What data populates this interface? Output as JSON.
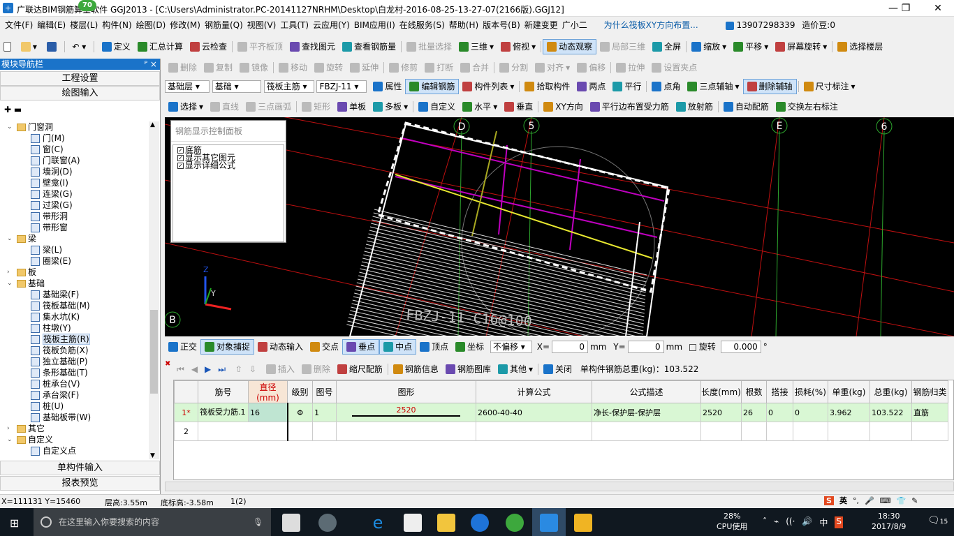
{
  "window": {
    "title": "广联达BIM钢筋算量软件 GGJ2013 - [C:\\Users\\Administrator.PC-20141127NRHM\\Desktop\\白龙村-2016-08-25-13-27-07(2166版).GGJ12]",
    "badge": "70"
  },
  "menu": {
    "items": [
      "文件(F)",
      "编辑(E)",
      "楼层(L)",
      "构件(N)",
      "绘图(D)",
      "修改(M)",
      "钢筋量(Q)",
      "视图(V)",
      "工具(T)",
      "云应用(Y)",
      "BIM应用(I)",
      "在线服务(S)",
      "帮助(H)",
      "版本号(B)",
      "新建变更",
      "广小二"
    ],
    "question": "为什么筏板XY方向布置...",
    "phone": "13907298339",
    "price": "造价豆:0"
  },
  "toolbar1": {
    "items": [
      "定义",
      "汇总计算",
      "云检查",
      "平齐板顶",
      "查找图元",
      "查看钢筋量",
      "批量选择",
      "三维",
      "俯视",
      "动态观察",
      "局部三维",
      "全屏",
      "缩放",
      "平移",
      "屏幕旋转",
      "选择楼层"
    ]
  },
  "toolbar2": {
    "items": [
      "删除",
      "复制",
      "镜像",
      "移动",
      "旋转",
      "延伸",
      "修剪",
      "打断",
      "合并",
      "分割",
      "对齐",
      "偏移",
      "拉伸",
      "设置夹点"
    ]
  },
  "toolbar3": {
    "floor": "基础层",
    "category": "基础",
    "type": "筏板主筋",
    "name": "FBZJ-11",
    "items": [
      "属性",
      "编辑钢筋",
      "构件列表",
      "拾取构件",
      "两点",
      "平行",
      "点角",
      "三点辅轴",
      "删除辅轴",
      "尺寸标注"
    ]
  },
  "toolbar4": {
    "items": [
      "选择",
      "直线",
      "三点画弧",
      "矩形",
      "单板",
      "多板",
      "自定义",
      "水平",
      "垂直",
      "XY方向",
      "平行边布置受力筋",
      "放射筋",
      "自动配筋",
      "交换左右标注"
    ]
  },
  "nav": {
    "header": "模块导航栏",
    "pin": "ᴾ ×",
    "btn_project": "工程设置",
    "btn_draw": "绘图输入",
    "btn_single": "单构件输入",
    "btn_report": "报表预览",
    "tree": [
      {
        "t": "folder",
        "label": "门窗洞",
        "lvl": 1,
        "open": true
      },
      {
        "t": "item",
        "label": "门(M)",
        "lvl": 2
      },
      {
        "t": "item",
        "label": "窗(C)",
        "lvl": 2
      },
      {
        "t": "item",
        "label": "门联窗(A)",
        "lvl": 2
      },
      {
        "t": "item",
        "label": "墙洞(D)",
        "lvl": 2
      },
      {
        "t": "item",
        "label": "壁龛(I)",
        "lvl": 2
      },
      {
        "t": "item",
        "label": "连梁(G)",
        "lvl": 2
      },
      {
        "t": "item",
        "label": "过梁(G)",
        "lvl": 2
      },
      {
        "t": "item",
        "label": "带形洞",
        "lvl": 2
      },
      {
        "t": "item",
        "label": "带形窗",
        "lvl": 2
      },
      {
        "t": "folder",
        "label": "梁",
        "lvl": 1,
        "open": true
      },
      {
        "t": "item",
        "label": "梁(L)",
        "lvl": 2
      },
      {
        "t": "item",
        "label": "圈梁(E)",
        "lvl": 2
      },
      {
        "t": "folder",
        "label": "板",
        "lvl": 1,
        "open": false
      },
      {
        "t": "folder",
        "label": "基础",
        "lvl": 1,
        "open": true
      },
      {
        "t": "item",
        "label": "基础梁(F)",
        "lvl": 2
      },
      {
        "t": "item",
        "label": "筏板基础(M)",
        "lvl": 2
      },
      {
        "t": "item",
        "label": "集水坑(K)",
        "lvl": 2
      },
      {
        "t": "item",
        "label": "柱墩(Y)",
        "lvl": 2
      },
      {
        "t": "item",
        "label": "筏板主筋(R)",
        "lvl": 2,
        "sel": true
      },
      {
        "t": "item",
        "label": "筏板负筋(X)",
        "lvl": 2
      },
      {
        "t": "item",
        "label": "独立基础(P)",
        "lvl": 2
      },
      {
        "t": "item",
        "label": "条形基础(T)",
        "lvl": 2
      },
      {
        "t": "item",
        "label": "桩承台(V)",
        "lvl": 2
      },
      {
        "t": "item",
        "label": "承台梁(F)",
        "lvl": 2
      },
      {
        "t": "item",
        "label": "桩(U)",
        "lvl": 2
      },
      {
        "t": "item",
        "label": "基础板带(W)",
        "lvl": 2
      },
      {
        "t": "folder",
        "label": "其它",
        "lvl": 1,
        "open": false
      },
      {
        "t": "folder",
        "label": "自定义",
        "lvl": 1,
        "open": true
      },
      {
        "t": "item",
        "label": "自定义点",
        "lvl": 2
      }
    ]
  },
  "canvas": {
    "panel_title": "钢筋显示控制面板",
    "checks": [
      "底筋",
      "显示其它图元",
      "显示详细公式"
    ],
    "axes": [
      "D",
      "5",
      "E",
      "6",
      "B"
    ],
    "label": "FBZJ-11-C16@100"
  },
  "snapbar": {
    "items": [
      "正交",
      "对象捕捉",
      "动态输入",
      "交点",
      "垂点",
      "中点",
      "顶点",
      "坐标"
    ],
    "offset": "不偏移",
    "x_label": "X=",
    "x_val": "0",
    "mm1": "mm",
    "y_label": "Y=",
    "y_val": "0",
    "mm2": "mm",
    "rotate": "旋转",
    "rot_val": "0.000",
    "deg": "°"
  },
  "rebar_toolbar": {
    "items": [
      "插入",
      "删除",
      "缩尺配筋",
      "钢筋信息",
      "钢筋图库",
      "其他",
      "关闭"
    ],
    "total": "单构件钢筋总重(kg)：103.522"
  },
  "table": {
    "headers": [
      "筋号",
      "直径(mm)",
      "级别",
      "图号",
      "图形",
      "计算公式",
      "公式描述",
      "长度(mm)",
      "根数",
      "搭接",
      "损耗(%)",
      "单重(kg)",
      "总重(kg)",
      "钢筋归类"
    ],
    "rows": [
      {
        "idx": "1*",
        "no": "筏板受力筋.1",
        "dia": "16",
        "grade": "Φ",
        "fig": "1",
        "shape": "2520",
        "formula": "2600-40-40",
        "desc": "净长-保护层-保护层",
        "len": "2520",
        "cnt": "26",
        "lap": "0",
        "loss": "0",
        "unit": "3.962",
        "total": "103.522",
        "cls": "直筋"
      },
      {
        "idx": "2"
      }
    ]
  },
  "status": {
    "coords": "X=111131 Y=15460",
    "floor_h": "层高:3.55m",
    "base_h": "底标高:-3.58m",
    "sel": "1(2)"
  },
  "tray": {
    "ime": "英",
    "cpu": "28%",
    "cpu_label": "CPU使用",
    "lang": "中",
    "time": "18:30",
    "date": "2017/8/9",
    "notif": "15"
  },
  "taskbar": {
    "search": "在这里输入你要搜索的内容"
  },
  "colors": {
    "accent": "#1a73c9",
    "canvas": "#000000",
    "grid_row": "#d9f7d4"
  }
}
